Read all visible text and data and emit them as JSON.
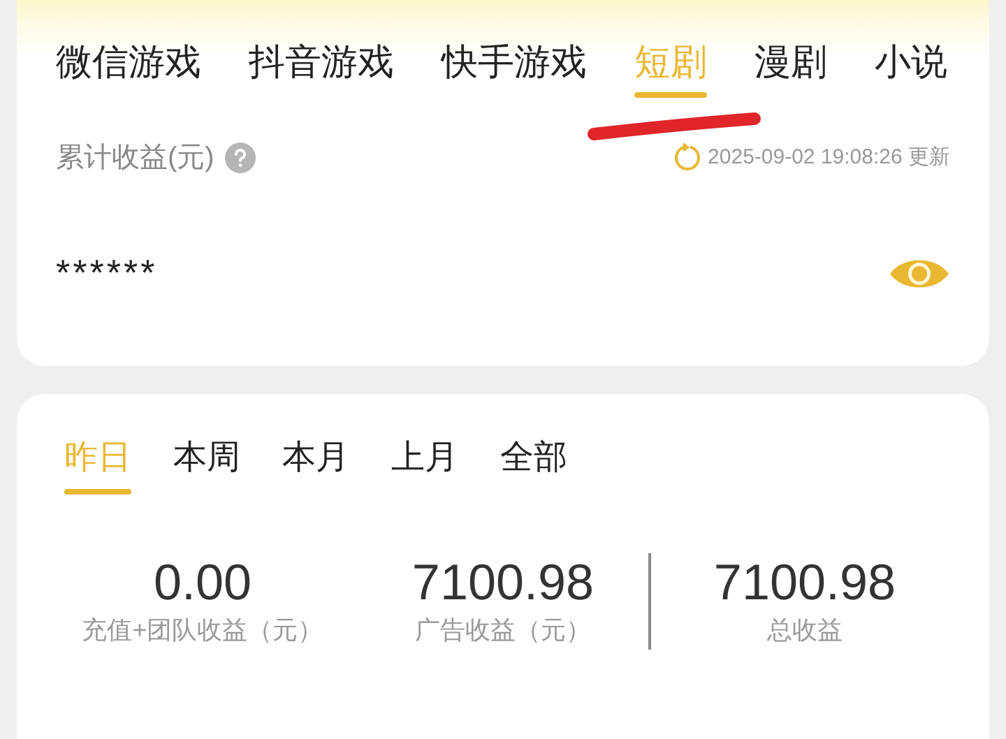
{
  "category_tabs": [
    {
      "label": "微信游戏",
      "selected": false
    },
    {
      "label": "抖音游戏",
      "selected": false
    },
    {
      "label": "快手游戏",
      "selected": false
    },
    {
      "label": "短剧",
      "selected": true
    },
    {
      "label": "漫剧",
      "selected": false
    },
    {
      "label": "小说",
      "selected": false
    }
  ],
  "earnings": {
    "label": "累计收益(元)",
    "updated": "2025-09-02 19:08:26 更新",
    "value": "******"
  },
  "period_tabs": [
    {
      "label": "昨日",
      "selected": true
    },
    {
      "label": "本周",
      "selected": false
    },
    {
      "label": "本月",
      "selected": false
    },
    {
      "label": "上月",
      "selected": false
    },
    {
      "label": "全部",
      "selected": false
    }
  ],
  "stats": [
    {
      "value": "0.00",
      "label": "充值+团队收益（元）"
    },
    {
      "value": "7100.98",
      "label": "广告收益（元）"
    },
    {
      "value": "7100.98",
      "label": "总收益"
    }
  ]
}
